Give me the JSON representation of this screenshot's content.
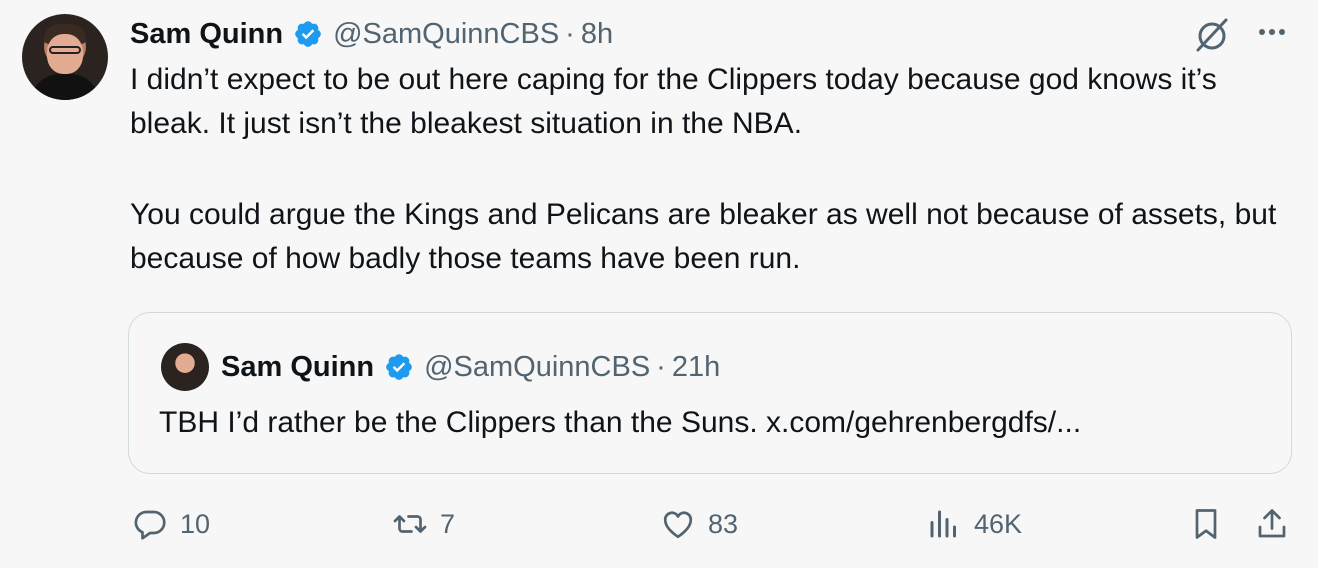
{
  "tweet": {
    "author_name": "Sam Quinn",
    "handle": "@SamQuinnCBS",
    "separator": "·",
    "time": "8h",
    "paragraph1": "I didn’t expect to be out here caping for the Clippers today because god knows it’s bleak. It just isn’t the bleakest situation in the NBA.",
    "paragraph2": "You could argue the Kings and Pelicans are bleaker as well not because of assets, but because of how badly those teams have been run."
  },
  "quote": {
    "author_name": "Sam Quinn",
    "handle": "@SamQuinnCBS",
    "separator": "·",
    "time": "21h",
    "text": "TBH I’d rather be the Clippers than the Suns. x.com/gehrenbergdfs/..."
  },
  "actions": {
    "replies": "10",
    "retweets": "7",
    "likes": "83",
    "views": "46K"
  },
  "icons": [
    "verified-badge-icon",
    "grok-icon",
    "more-icon",
    "reply-icon",
    "retweet-icon",
    "like-icon",
    "views-icon",
    "bookmark-icon",
    "share-icon"
  ],
  "colors": {
    "verified": "#1d9bf0",
    "secondary_text": "#536471",
    "primary_text": "#0f1419",
    "border": "#cfd9de",
    "background": "#f7f7f7"
  }
}
